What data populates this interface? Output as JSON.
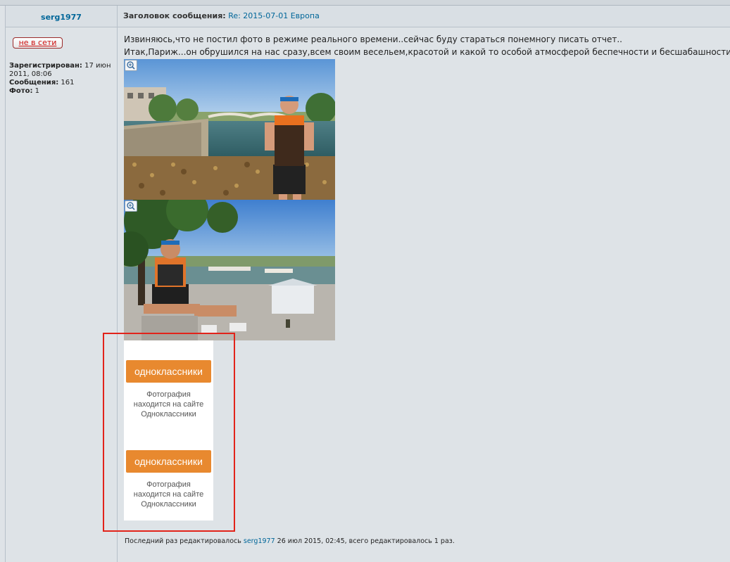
{
  "post": {
    "author": "serg1977",
    "subject_label": "Заголовок сообщения:",
    "subject_value": "Re: 2015-07-01 Европа"
  },
  "profile": {
    "status": "не в сети",
    "registered_label": "Зарегистрирован:",
    "registered_value": "17 июн 2011, 08:06",
    "messages_label": "Сообщения:",
    "messages_value": "161",
    "photos_label": "Фото:",
    "photos_value": "1"
  },
  "message": {
    "line1": "Извиняюсь,что не постил фото в режиме реального времени..сейчас буду стараться понемногу писать отчет..",
    "line2": "Итак,Париж...он обрушился на нас сразу,всем своим весельем,красотой и какой то особой атмосферой беспечности и бесшабашности.."
  },
  "ok_embeds": [
    {
      "button": "одноклассники",
      "note_line1": "Фотография",
      "note_line2": "находится на сайте",
      "note_line3": "Одноклассники"
    },
    {
      "button": "одноклассники",
      "note_line1": "Фотография",
      "note_line2": "находится на сайте",
      "note_line3": "Одноклассники"
    }
  ],
  "edit_note": {
    "prefix": "Последний раз редактировалось",
    "user": "serg1977",
    "suffix": "26 июл 2015, 02:45, всего редактировалось 1 раз."
  },
  "colors": {
    "link": "#006699",
    "ok_orange": "#e8892f",
    "highlight_red": "#e2231a",
    "background": "#dee3e7"
  }
}
